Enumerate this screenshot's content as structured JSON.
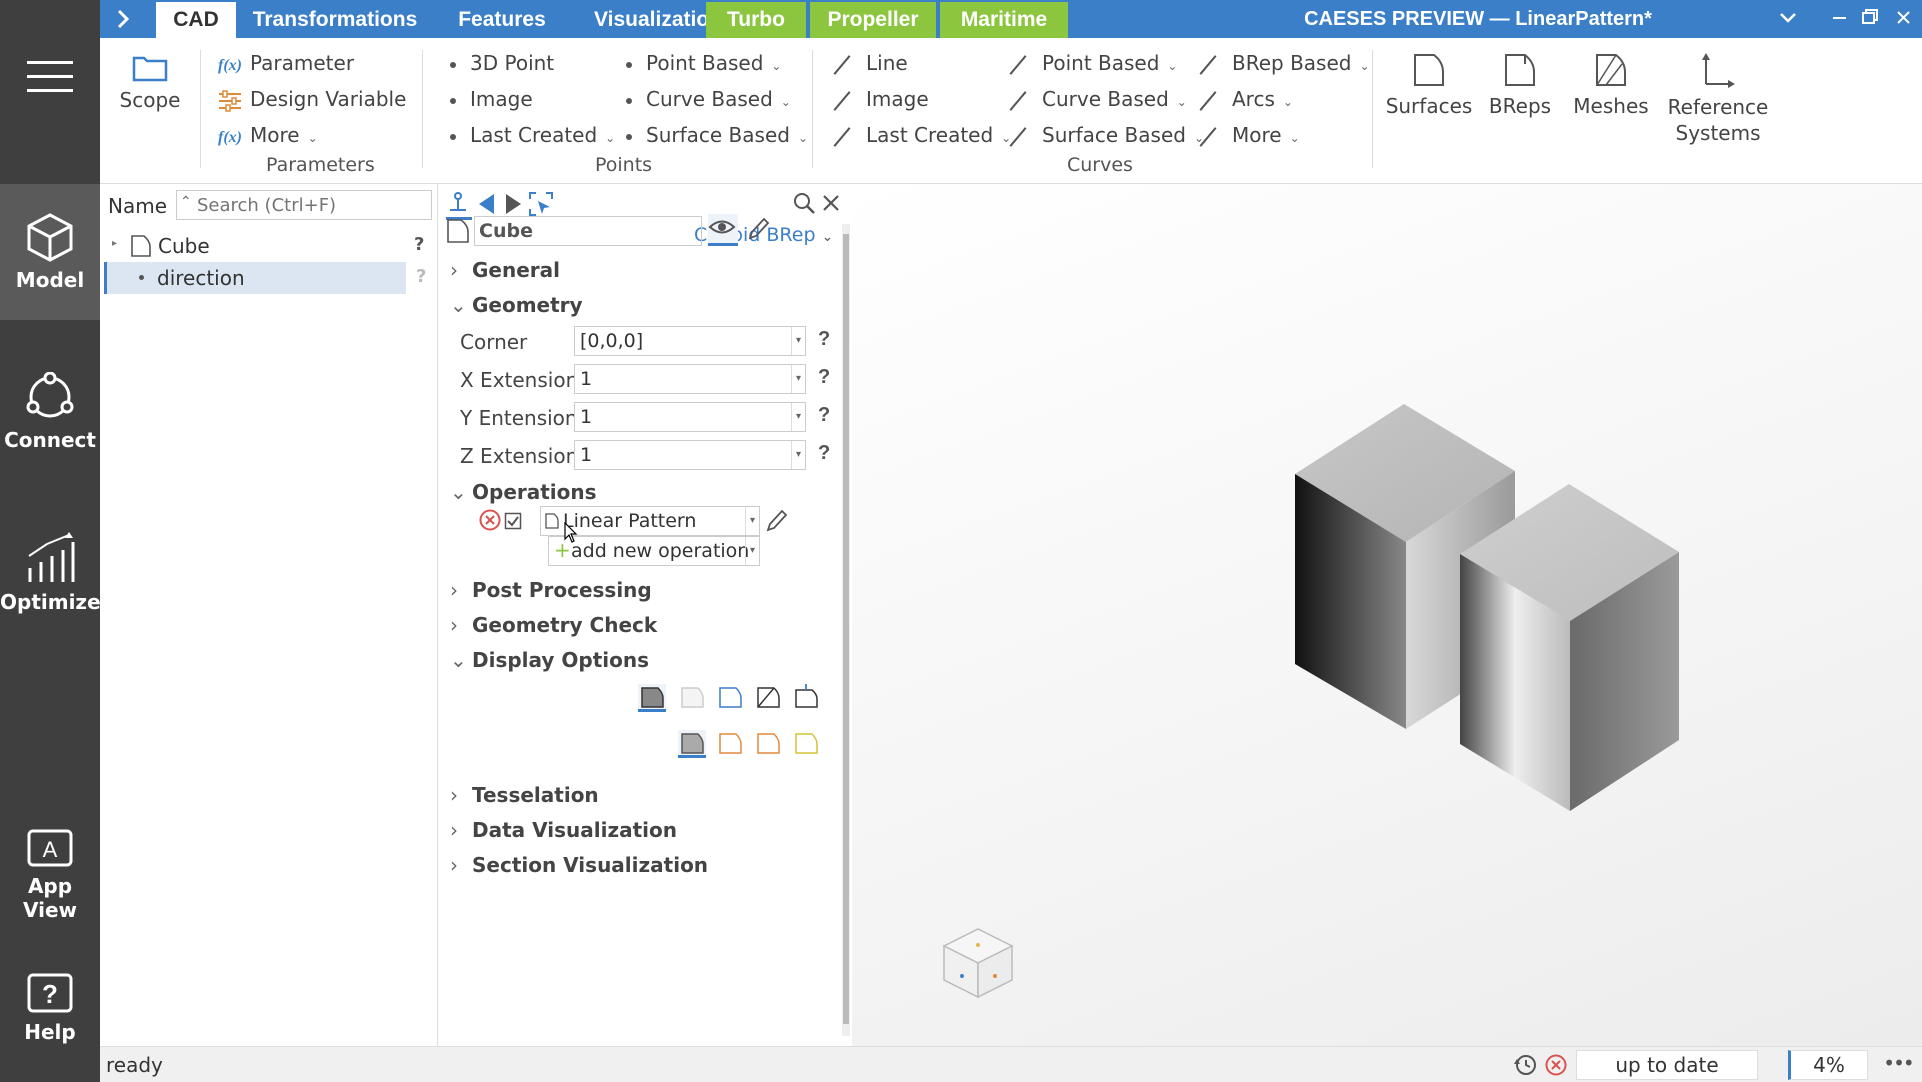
{
  "rail": {
    "items": [
      {
        "label": "Model"
      },
      {
        "label": "Connect"
      },
      {
        "label": "Optimize"
      },
      {
        "label": "App View"
      },
      {
        "label": "Help"
      }
    ]
  },
  "topbar": {
    "tabs": [
      {
        "label": "CAD"
      },
      {
        "label": "Transformations"
      },
      {
        "label": "Features"
      },
      {
        "label": "Visualization"
      },
      {
        "label": "Turbo"
      },
      {
        "label": "Propeller"
      },
      {
        "label": "Maritime"
      }
    ],
    "window_title": "CAESES PREVIEW — LinearPattern*",
    "accent_color": "#3a7fc8",
    "green_tab_color": "#8cc63f"
  },
  "ribbon": {
    "scope": "Scope",
    "parameters": {
      "items": [
        "Parameter",
        "Design Variable",
        "More"
      ],
      "group": "Parameters"
    },
    "points": {
      "col1": [
        "3D Point",
        "Image",
        "Last Created"
      ],
      "col2": [
        "Point Based",
        "Curve Based",
        "Surface Based"
      ],
      "group": "Points"
    },
    "curves": {
      "col1": [
        "Line",
        "Image",
        "Last Created"
      ],
      "col2": [
        "Point Based",
        "Curve Based",
        "Surface Based"
      ],
      "col3": [
        "BRep Based",
        "Arcs",
        "More"
      ],
      "group": "Curves"
    },
    "big": [
      "Surfaces",
      "BReps",
      "Meshes",
      "Reference Systems"
    ]
  },
  "tree": {
    "name_label": "Name",
    "search_placeholder": "Search (Ctrl+F)",
    "items": [
      {
        "label": "Cube"
      },
      {
        "label": "direction"
      }
    ],
    "help": "?"
  },
  "props": {
    "type": "Cuboid BRep",
    "name": "Cube",
    "sections": {
      "general": "General",
      "geometry": "Geometry",
      "operations": "Operations",
      "post": "Post Processing",
      "check": "Geometry Check",
      "display": "Display Options",
      "tess": "Tesselation",
      "datavis": "Data Visualization",
      "secvis": "Section Visualization"
    },
    "fields": [
      {
        "label": "Corner",
        "value": "[0,0,0]"
      },
      {
        "label": "X Extension",
        "value": "1"
      },
      {
        "label": "Y Entension",
        "value": "1"
      },
      {
        "label": "Z Extension",
        "value": "1"
      }
    ],
    "operation": "Linear Pattern",
    "add_operation": "add new operation",
    "help": "?"
  },
  "status": {
    "text": "ready",
    "state": "up to date",
    "zoom": "4%",
    "more": "•••"
  }
}
